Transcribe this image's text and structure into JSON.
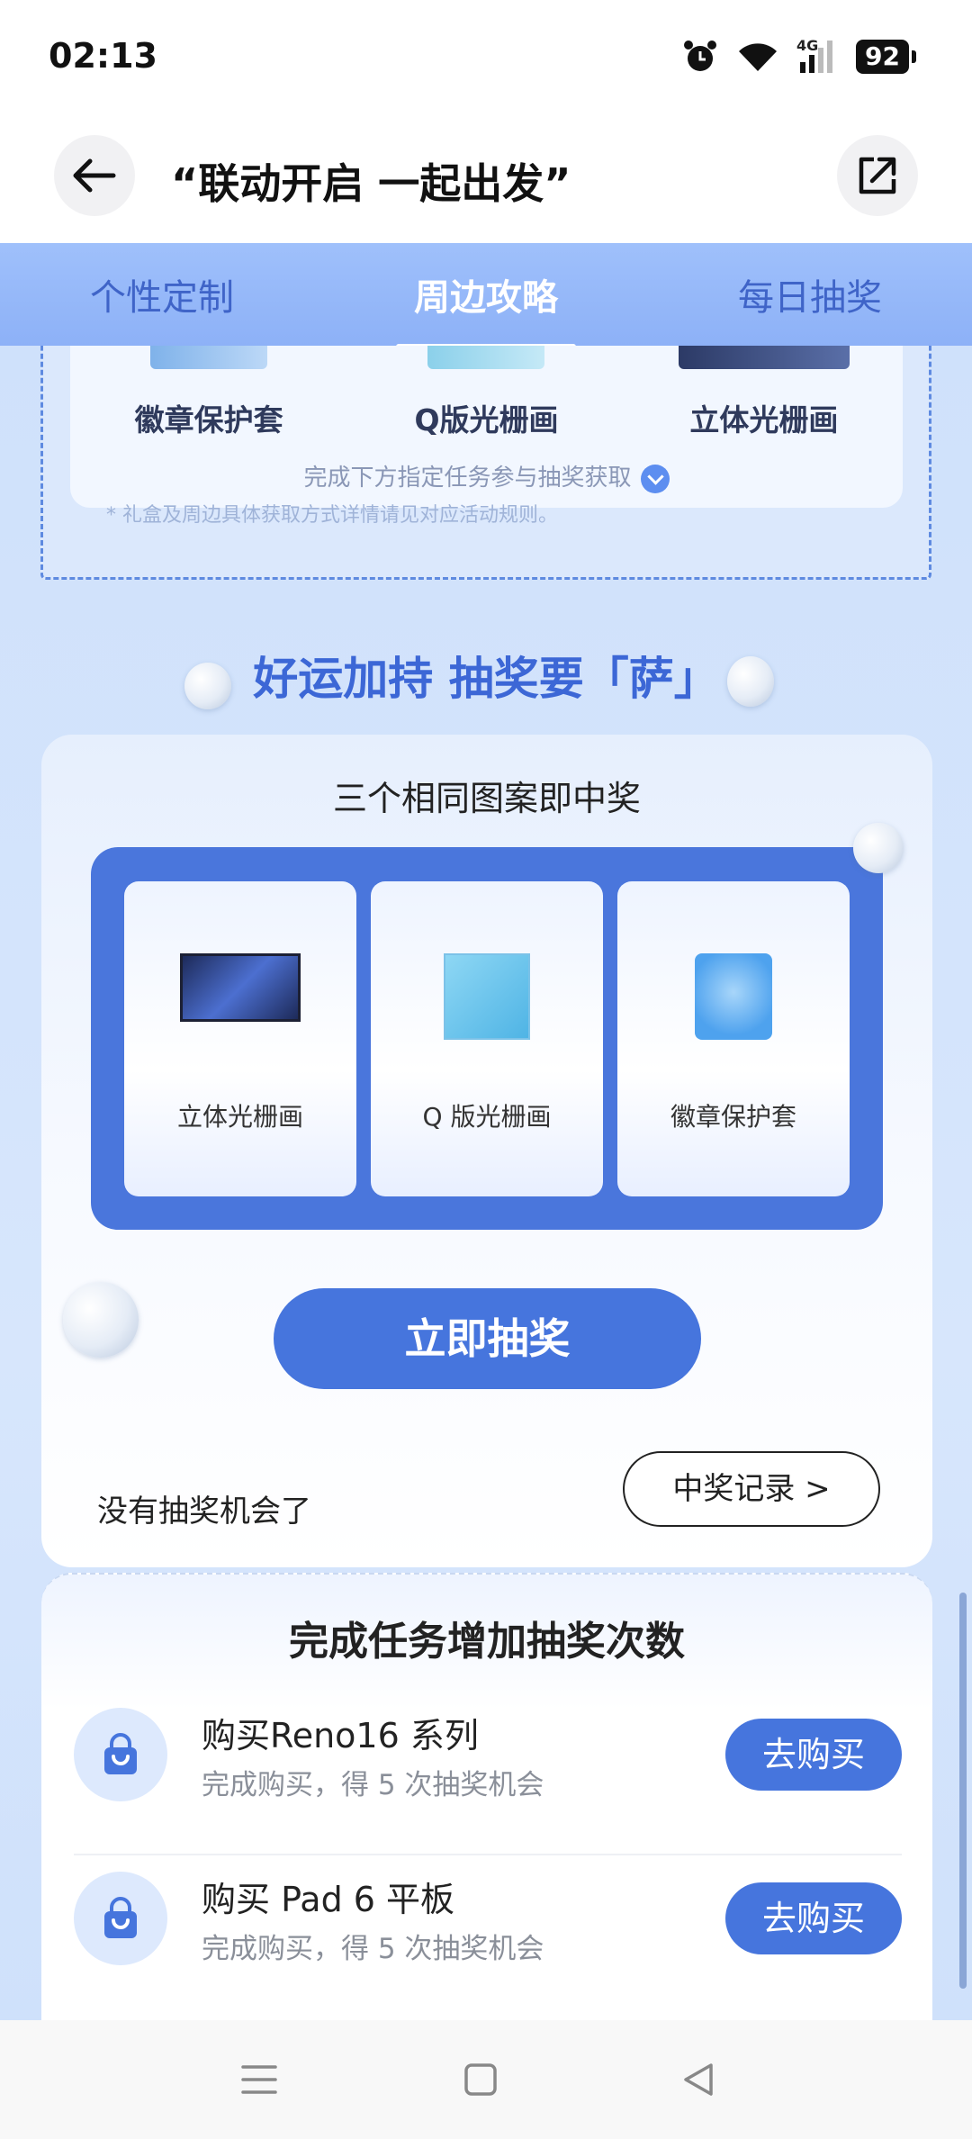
{
  "status_bar": {
    "time": "02:13",
    "network": "4G",
    "battery": "92"
  },
  "header": {
    "title": "“联动开启 一起出发”"
  },
  "tabs": [
    {
      "label": "个性定制",
      "active": false
    },
    {
      "label": "周边攻略",
      "active": true
    },
    {
      "label": "每日抽奖",
      "active": false
    }
  ],
  "prize_preview": {
    "items": [
      "徽章保护套",
      "Q版光栅画",
      "立体光栅画"
    ],
    "hint": "完成下方指定任务参与抽奖获取",
    "note": "* 礼盒及周边具体获取方式详情请见对应活动规则。"
  },
  "lottery": {
    "section_title": "好运加持 抽奖要「萨」",
    "subtitle": "三个相同图案即中奖",
    "slots": [
      "立体光栅画",
      "Q 版光栅画",
      "徽章保护套"
    ],
    "draw_label": "立即抽奖",
    "chances_text": "没有抽奖机会了",
    "record_label": "中奖记录 >"
  },
  "tasks": {
    "title": "完成任务增加抽奖次数",
    "items": [
      {
        "name": "购买Reno16 系列",
        "desc": "完成购买，得 5 次抽奖机会",
        "button": "去购买"
      },
      {
        "name": "购买 Pad 6 平板",
        "desc": "完成购买，得 5 次抽奖机会",
        "button": "去购买"
      }
    ]
  },
  "colors": {
    "accent": "#4675dd",
    "tab_bar": "#9fc0fb",
    "title_blue": "#3c67d6"
  }
}
